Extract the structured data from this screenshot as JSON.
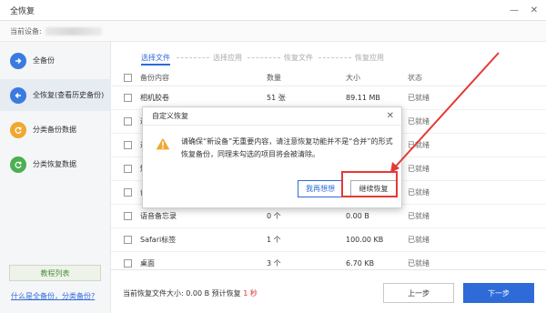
{
  "window": {
    "title": "全恢复",
    "device_label": "当前设备:",
    "controls": [
      "minimize-icon",
      "close-icon"
    ]
  },
  "sidebar": {
    "items": [
      {
        "label": "全备份",
        "icon": "arrow-right-icon",
        "color": "#3a7be0"
      },
      {
        "label": "全恢复(查看历史备份)",
        "icon": "arrow-left-icon",
        "color": "#3a7be0"
      },
      {
        "label": "分类备份数据",
        "icon": "refresh-icon",
        "color": "#f0a830"
      },
      {
        "label": "分类恢复数据",
        "icon": "refresh-icon",
        "color": "#4caf50"
      }
    ],
    "tutorial_button": "教程列表",
    "help_link": "什么是全备份，分类备份?"
  },
  "steps": [
    {
      "label": "选择文件",
      "active": true
    },
    {
      "label": "选择应用",
      "active": false
    },
    {
      "label": "恢复文件",
      "active": false
    },
    {
      "label": "恢复应用",
      "active": false
    }
  ],
  "table": {
    "headers": {
      "name": "备份内容",
      "count": "数量",
      "size": "大小",
      "status": "状态"
    },
    "rows": [
      {
        "name": "相机胶卷",
        "count": "51 张",
        "size": "89.11 MB",
        "status": "已就绪"
      },
      {
        "name": "通",
        "count": "",
        "size": "",
        "status": "已就绪"
      },
      {
        "name": "通",
        "count": "",
        "size": "",
        "status": "已就绪"
      },
      {
        "name": "短",
        "count": "",
        "size": "",
        "status": "已就绪"
      },
      {
        "name": "备",
        "count": "",
        "size": "",
        "status": "已就绪"
      },
      {
        "name": "语音备忘录",
        "count": "0 个",
        "size": "0.00 B",
        "status": "已就绪"
      },
      {
        "name": "Safari标签",
        "count": "1 个",
        "size": "100.00 KB",
        "status": "已就绪"
      },
      {
        "name": "桌面",
        "count": "3 个",
        "size": "6.70 KB",
        "status": "已就绪"
      }
    ]
  },
  "footer": {
    "size_label": "当前恢复文件大小:",
    "size_value": "0.00 B",
    "eta_label": "预计恢复",
    "eta_value": "1 秒",
    "prev_button": "上一步",
    "next_button": "下一步"
  },
  "dialog": {
    "title": "自定义恢复",
    "message": "请确保“新设备”无重要内容，请注意恢复功能并不是“合并”的形式恢复备份，同理未勾选的项目将会被清除。",
    "rethink_button": "我再想想",
    "continue_button": "继续恢复"
  },
  "colors": {
    "accent": "#2f6bd8",
    "highlight": "#e53935",
    "warning": "#f0a830"
  }
}
